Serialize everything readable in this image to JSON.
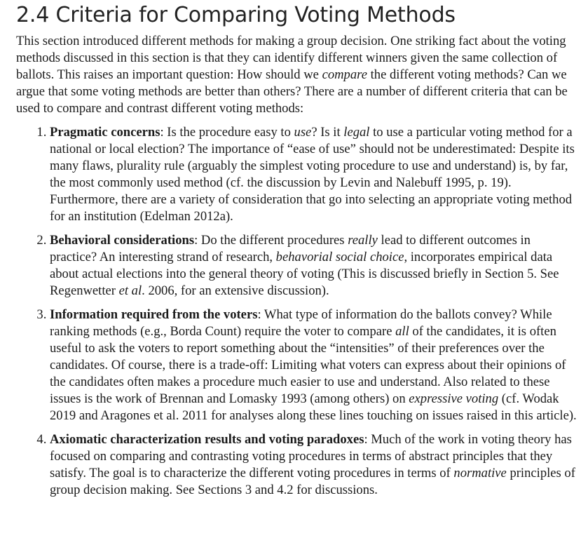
{
  "section": {
    "title": "2.4 Criteria for Comparing Voting Methods"
  },
  "intro": {
    "p1": "This section introduced different methods for making a group decision. One striking fact about the voting methods discussed in this section is that they can identify different winners given the same collection of ballots. This raises an important question: How should we ",
    "p1_em": "compare",
    "p1_tail": " the different voting methods? Can we argue that some voting methods are better than others? There are a number of different criteria that can be used to compare and contrast different voting methods:"
  },
  "criteria": [
    {
      "heading": "Pragmatic concerns",
      "t1": ": Is the procedure easy to ",
      "e1": "use",
      "t2": "? Is it ",
      "e2": "legal",
      "t3": " to use a particular voting method for a national or local election? The importance of “ease of use” should not be underestimated: Despite its many flaws, plurality rule (arguably the simplest voting procedure to use and understand) is, by far, the most commonly used method (cf. the discussion by Levin and Nalebuff 1995, p. 19). Furthermore, there are a variety of consideration that go into selecting an appropriate voting method for an institution (Edelman 2012a)."
    },
    {
      "heading": "Behavioral considerations",
      "t1": ": Do the different procedures ",
      "e1": "really",
      "t2": " lead to different outcomes in practice? An interesting strand of research, ",
      "e2": "behavorial social choice",
      "t3": ", incorporates empirical data about actual elections into the general theory of voting (This is discussed briefly in Section 5. See Regenwetter ",
      "e3": "et al",
      "t4": ". 2006, for an extensive discussion)."
    },
    {
      "heading": "Information required from the voters",
      "t1": ": What type of information do the ballots convey? While ranking methods (e.g., Borda Count) require the voter to compare ",
      "e1": "all",
      "t2": " of the candidates, it is often useful to ask the voters to report something about the “intensities” of their preferences over the candidates. Of course, there is a trade-off: Limiting what voters can express about their opinions of the candidates often makes a procedure much easier to use and understand. Also related to these issues is the work of Brennan and Lomasky 1993 (among others) on ",
      "e2": "expressive voting",
      "t3": " (cf. Wodak 2019 and Aragones et al. 2011 for analyses along these lines touching on issues raised in this article)."
    },
    {
      "heading": "Axiomatic characterization results and voting paradoxes",
      "t1": ": Much of the work in voting theory has focused on comparing and contrasting voting procedures in terms of abstract principles that they satisfy. The goal is to characterize the different voting procedures in terms of ",
      "e1": "normative",
      "t2": " principles of group decision making. See Sections 3 and 4.2 for discussions."
    }
  ]
}
